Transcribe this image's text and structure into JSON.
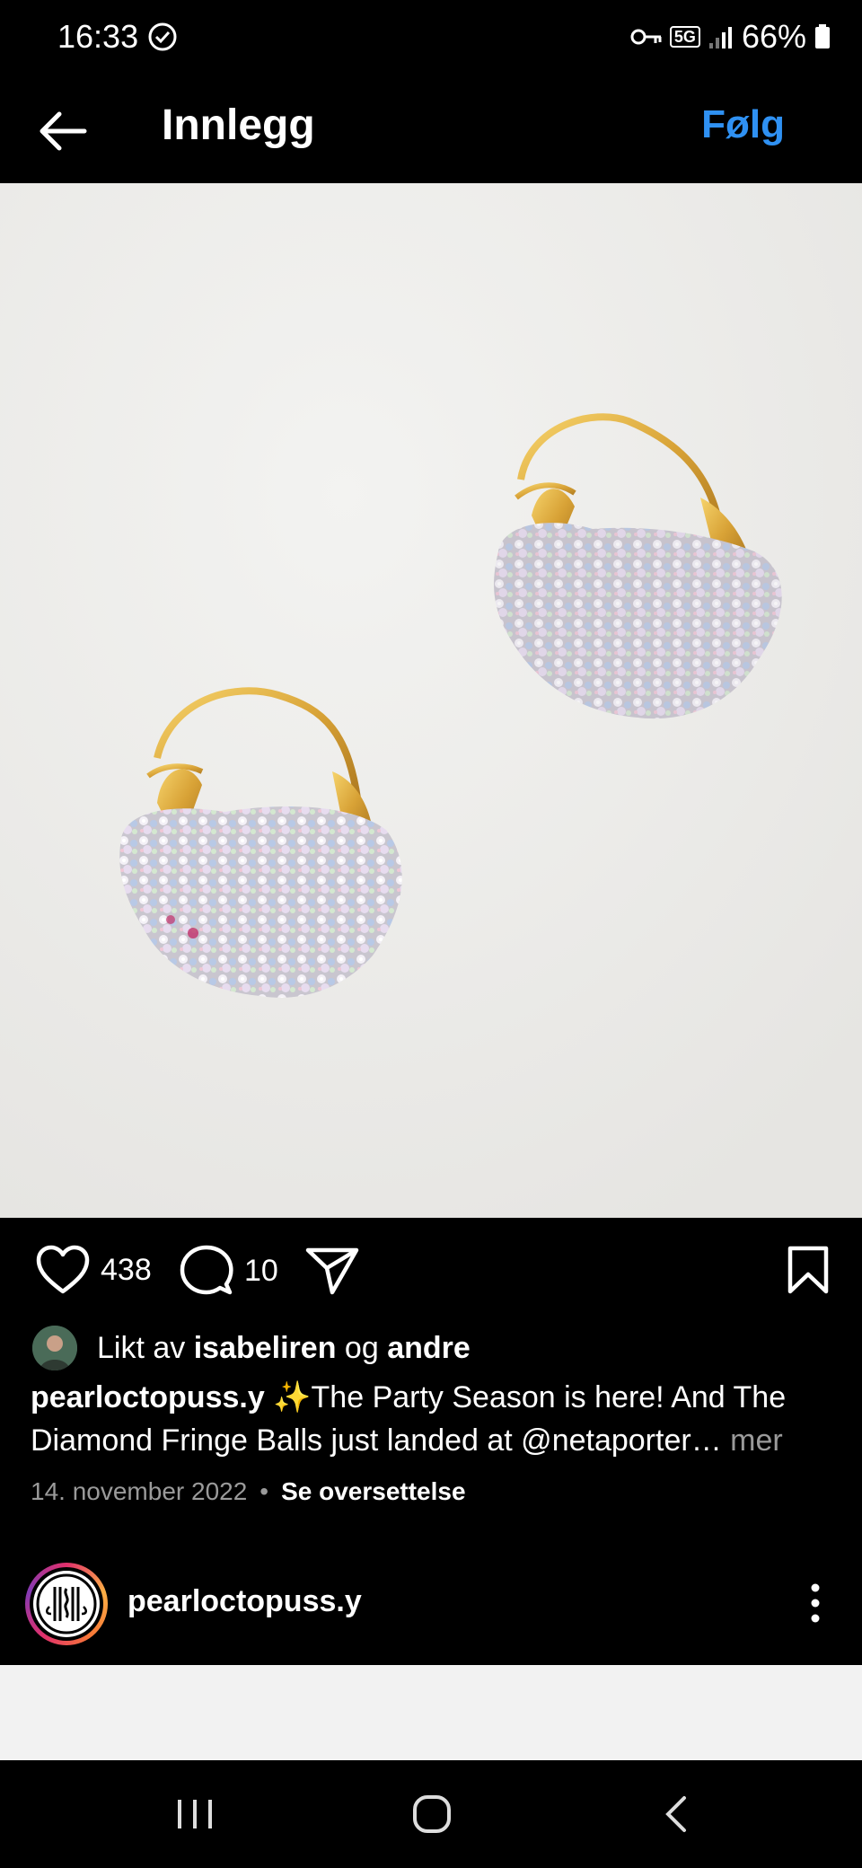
{
  "status_bar": {
    "time": "16:33",
    "network": "5G",
    "battery": "66%"
  },
  "header": {
    "title": "Innlegg",
    "follow_label": "Følg"
  },
  "post": {
    "image_description_icon": "earrings-photo",
    "likes_count": "438",
    "comments_count": "10",
    "liked_by": {
      "prefix": "Likt av ",
      "user": "isabeliren",
      "conj": " og ",
      "others": "andre"
    },
    "caption": {
      "username": "pearloctopuss.y",
      "text": " ✨The Party Season is here! And The Diamond Fringe Balls just landed at @netaporter",
      "ellipsis": "…",
      "more": " mer"
    },
    "date": "14. november 2022",
    "translate_label": "Se oversettelse"
  },
  "next_post": {
    "username": "pearloctopuss.y"
  },
  "colors": {
    "accent": "#2f91f3",
    "background": "#000000",
    "muted": "#9a9a9a"
  }
}
